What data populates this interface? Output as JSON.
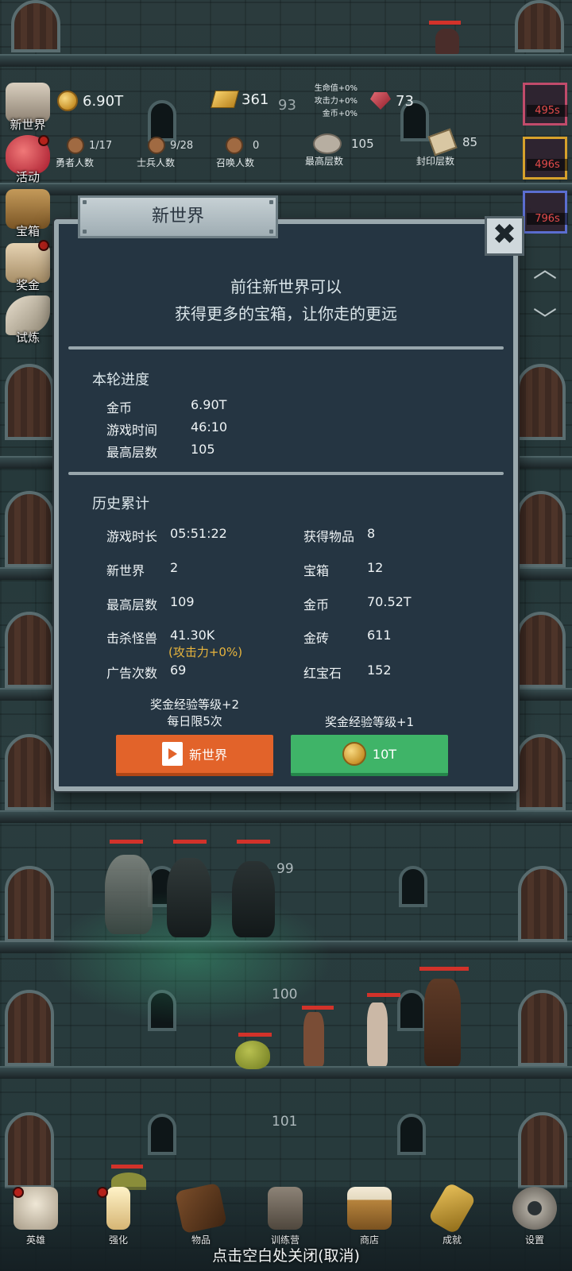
{
  "hud": {
    "gold": "6.90T",
    "gold_bars": "361",
    "gold_bars_extra": "93",
    "bonuses": [
      "生命值+0%",
      "攻击力+0%",
      "金币+0%"
    ],
    "ruby": "73",
    "heroes": {
      "value": "1/17",
      "label": "勇者人数"
    },
    "soldiers": {
      "value": "9/28",
      "label": "士兵人数"
    },
    "summons": {
      "value": "0",
      "label": "召唤人数"
    },
    "max_floor": {
      "value": "105",
      "label": "最高层数"
    },
    "sealed_floor": {
      "value": "85",
      "label": "封印层数"
    }
  },
  "side_menu": [
    {
      "label": "新世界",
      "icon": "new-world-icon"
    },
    {
      "label": "活动",
      "icon": "heart-icon"
    },
    {
      "label": "宝箱",
      "icon": "treasure-chest-icon"
    },
    {
      "label": "奖金",
      "icon": "reward-icon"
    },
    {
      "label": "试炼",
      "icon": "feather-icon"
    }
  ],
  "bosses": [
    {
      "time": "495s"
    },
    {
      "time": "496s"
    },
    {
      "time": "796s"
    }
  ],
  "floors": {
    "f99": "99",
    "f100": "100",
    "f101": "101"
  },
  "dialog": {
    "title": "新世界",
    "close": "✖",
    "intro_line1": "前往新世界可以",
    "intro_line2": "获得更多的宝箱，让你走的更远",
    "current": {
      "title": "本轮进度",
      "rows": [
        {
          "label": "金币",
          "value": "6.90T"
        },
        {
          "label": "游戏时间",
          "value": "46:10"
        },
        {
          "label": "最高层数",
          "value": "105"
        }
      ]
    },
    "history": {
      "title": "历史累计",
      "left": [
        {
          "label": "游戏时长",
          "value": "05:51:22"
        },
        {
          "label": "新世界",
          "value": "2"
        },
        {
          "label": "最高层数",
          "value": "109"
        },
        {
          "label": "击杀怪兽",
          "value": "41.30K"
        },
        {
          "label": "广告次数",
          "value": "69"
        }
      ],
      "right": [
        {
          "label": "获得物品",
          "value": "8"
        },
        {
          "label": "宝箱",
          "value": "12"
        },
        {
          "label": "金币",
          "value": "70.52T"
        },
        {
          "label": "金砖",
          "value": "611"
        },
        {
          "label": "红宝石",
          "value": "152"
        }
      ],
      "attack_bonus": "(攻击力+0%)"
    },
    "ad_note_line1": "奖金经验等级+2",
    "ad_note_line2": "每日限5次",
    "coin_note": "奖金经验等级+1",
    "ad_button": "新世界",
    "coin_button": "10T"
  },
  "bottom_nav": [
    {
      "label": "英雄",
      "icon": "skull-icon"
    },
    {
      "label": "强化",
      "icon": "candle-icon"
    },
    {
      "label": "物品",
      "icon": "book-icon"
    },
    {
      "label": "训练营",
      "icon": "lantern-icon"
    },
    {
      "label": "商店",
      "icon": "beer-mug-icon"
    },
    {
      "label": "成就",
      "icon": "key-icon"
    },
    {
      "label": "设置",
      "icon": "gear-icon"
    }
  ],
  "close_hint": "点击空白处关闭(取消)",
  "colors": {
    "orange_button": "#e2632a",
    "green_button": "#3fb468",
    "dialog_bg": "#253542",
    "boss_timer": "#e44b4b",
    "bonus_text": "#e7b43d"
  }
}
